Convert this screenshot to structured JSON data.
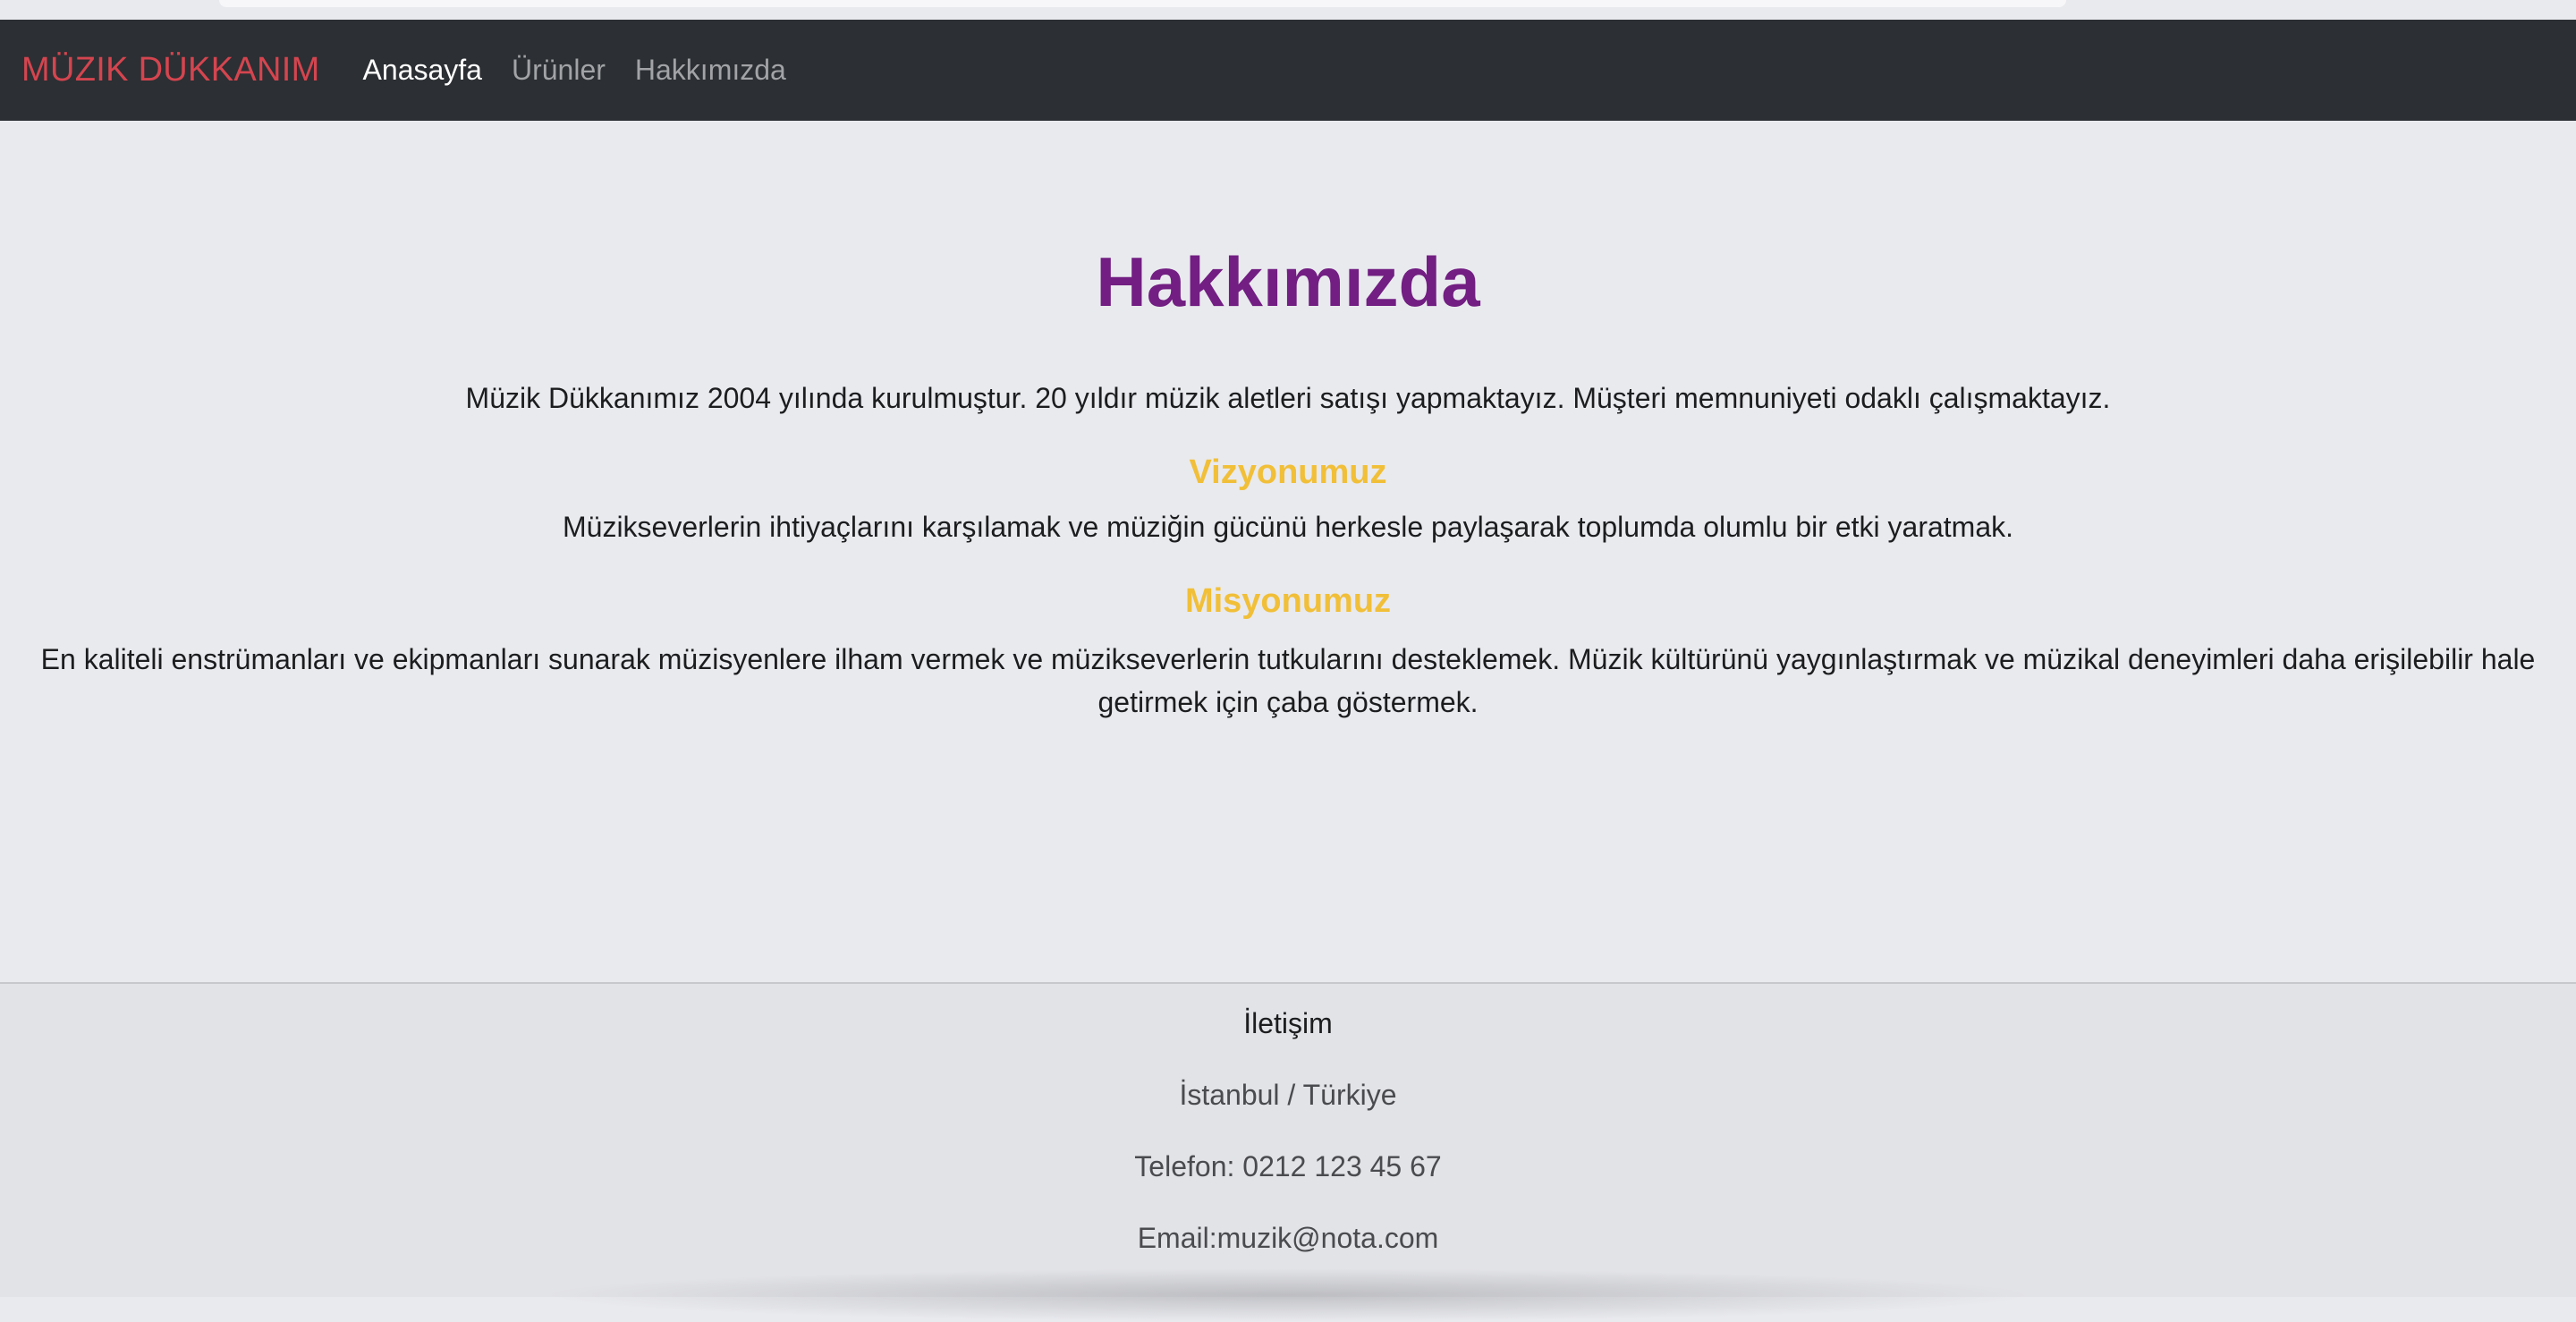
{
  "navbar": {
    "brand": "MÜZIK DÜKKANIM",
    "links": [
      "Anasayfa",
      "Ürünler",
      "Hakkımızda"
    ]
  },
  "main": {
    "title": "Hakkımızda",
    "intro": "Müzik Dükkanımız 2004 yılında kurulmuştur. 20 yıldır müzik aletleri satışı yapmaktayız. Müşteri memnuniyeti odaklı çalışmaktayız.",
    "vision_heading": "Vizyonumuz",
    "vision_text": "Müzikseverlerin ihtiyaçlarını karşılamak ve müziğin gücünü herkesle paylaşarak toplumda olumlu bir etki yaratmak.",
    "mission_heading": "Misyonumuz",
    "mission_text": "En kaliteli enstrümanları ve ekipmanları sunarak müzisyenlere ilham vermek ve müzikseverlerin tutkularını desteklemek. Müzik kültürünü yaygınlaştırmak ve müzikal deneyimleri daha erişilebilir hale getirmek için çaba göstermek."
  },
  "footer": {
    "title": "İletişim",
    "address": "İstanbul / Türkiye",
    "phone": "Telefon: 0212 123 45 67",
    "email": "Email:muzik@nota.com"
  },
  "colors": {
    "navbar_bg": "#2c2f33",
    "brand": "#d4454f",
    "title": "#721e82",
    "heading_accent": "#f1bf38",
    "page_bg": "#e9eaee"
  }
}
